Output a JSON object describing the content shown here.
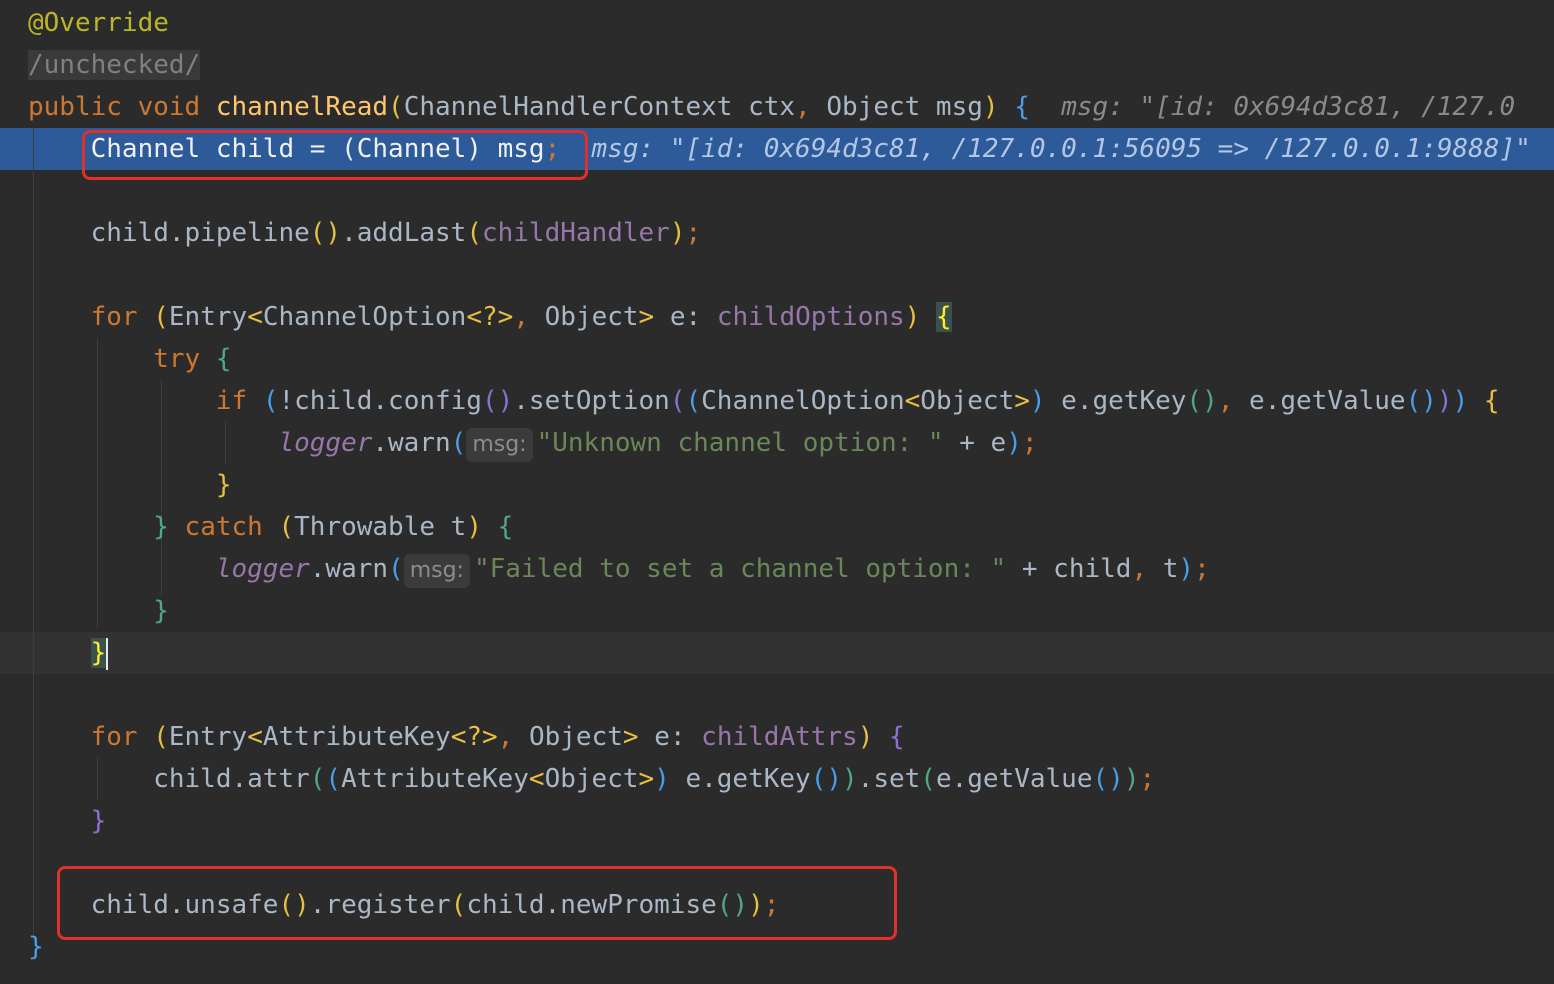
{
  "editor": {
    "lines": [
      {
        "tokens": [
          {
            "t": "@Override",
            "c": "ann"
          }
        ]
      },
      {
        "tokens": [
          {
            "t": "/unchecked/",
            "c": "comment"
          }
        ]
      },
      {
        "tokens": [
          {
            "t": "public",
            "c": "kw"
          },
          {
            "t": " "
          },
          {
            "t": "void",
            "c": "kw"
          },
          {
            "t": " "
          },
          {
            "t": "channelRead",
            "c": "fn"
          },
          {
            "t": "(",
            "c": "p-yellow"
          },
          {
            "t": "ChannelHandlerContext ctx"
          },
          {
            "t": ", ",
            "c": "kw"
          },
          {
            "t": "Object msg"
          },
          {
            "t": ")",
            "c": "p-yellow"
          },
          {
            "t": " "
          },
          {
            "t": "{",
            "c": "p-blue"
          },
          {
            "t": "  "
          },
          {
            "t": "msg: \"[id: 0x694d3c81, /127.0",
            "c": "inlay"
          }
        ]
      },
      {
        "tokens": [
          {
            "t": "    "
          },
          {
            "t": "Channel child = (Channel) msg",
            "c": "exec-text"
          },
          {
            "t": ";",
            "c": "kw"
          },
          {
            "t": "  "
          },
          {
            "t": "msg: \"[id: 0x694d3c81, /127.0.0.1:56095 => /127.0.0.1:9888]\"",
            "c": "exec-inlay"
          }
        ]
      },
      {
        "tokens": []
      },
      {
        "tokens": [
          {
            "t": "    child.pipeline"
          },
          {
            "t": "()",
            "c": "p-yellow"
          },
          {
            "t": ".addLast"
          },
          {
            "t": "(",
            "c": "p-yellow"
          },
          {
            "t": "childHandler",
            "c": "field"
          },
          {
            "t": ")",
            "c": "p-yellow"
          },
          {
            "t": ";",
            "c": "kw"
          }
        ]
      },
      {
        "tokens": []
      },
      {
        "tokens": [
          {
            "t": "    "
          },
          {
            "t": "for",
            "c": "kw"
          },
          {
            "t": " "
          },
          {
            "t": "(",
            "c": "p-yellow"
          },
          {
            "t": "Entry"
          },
          {
            "t": "<",
            "c": "p-yellow"
          },
          {
            "t": "ChannelOption"
          },
          {
            "t": "<?>",
            "c": "p-yellow"
          },
          {
            "t": ", ",
            "c": "kw"
          },
          {
            "t": "Object"
          },
          {
            "t": ">",
            "c": "p-yellow"
          },
          {
            "t": " e: "
          },
          {
            "t": "childOptions",
            "c": "field"
          },
          {
            "t": ")",
            "c": "p-yellow"
          },
          {
            "t": " "
          },
          {
            "t": "{",
            "c": "brace-match"
          }
        ]
      },
      {
        "tokens": [
          {
            "t": "        "
          },
          {
            "t": "try",
            "c": "kw"
          },
          {
            "t": " "
          },
          {
            "t": "{",
            "c": "p-green"
          }
        ]
      },
      {
        "tokens": [
          {
            "t": "            "
          },
          {
            "t": "if",
            "c": "kw"
          },
          {
            "t": " "
          },
          {
            "t": "(",
            "c": "p-blue"
          },
          {
            "t": "!child.config"
          },
          {
            "t": "()",
            "c": "p-purple"
          },
          {
            "t": ".setOption"
          },
          {
            "t": "(",
            "c": "p-purple"
          },
          {
            "t": "(",
            "c": "p-blue"
          },
          {
            "t": "ChannelOption"
          },
          {
            "t": "<",
            "c": "p-yellow"
          },
          {
            "t": "Object"
          },
          {
            "t": ">",
            "c": "p-yellow"
          },
          {
            "t": ")",
            "c": "p-blue"
          },
          {
            "t": " e.getKey"
          },
          {
            "t": "()",
            "c": "p-green"
          },
          {
            "t": ", ",
            "c": "kw"
          },
          {
            "t": "e.getValue"
          },
          {
            "t": "()",
            "c": "p-blue"
          },
          {
            "t": ")",
            "c": "p-purple"
          },
          {
            "t": ")",
            "c": "p-blue"
          },
          {
            "t": " "
          },
          {
            "t": "{",
            "c": "p-yellow"
          }
        ]
      },
      {
        "tokens": [
          {
            "t": "                "
          },
          {
            "t": "logger",
            "c": "static-field"
          },
          {
            "t": ".warn"
          },
          {
            "t": "(",
            "c": "p-blue"
          },
          {
            "t": "msg:",
            "c": "hint"
          },
          {
            "t": "\"Unknown channel option: \"",
            "c": "str"
          },
          {
            "t": " + e"
          },
          {
            "t": ")",
            "c": "p-blue"
          },
          {
            "t": ";",
            "c": "kw"
          }
        ]
      },
      {
        "tokens": [
          {
            "t": "            "
          },
          {
            "t": "}",
            "c": "p-yellow"
          }
        ]
      },
      {
        "tokens": [
          {
            "t": "        "
          },
          {
            "t": "}",
            "c": "p-green"
          },
          {
            "t": " "
          },
          {
            "t": "catch",
            "c": "kw"
          },
          {
            "t": " "
          },
          {
            "t": "(",
            "c": "p-yellow"
          },
          {
            "t": "Throwable t"
          },
          {
            "t": ")",
            "c": "p-yellow"
          },
          {
            "t": " "
          },
          {
            "t": "{",
            "c": "p-green"
          }
        ]
      },
      {
        "tokens": [
          {
            "t": "            "
          },
          {
            "t": "logger",
            "c": "static-field"
          },
          {
            "t": ".warn"
          },
          {
            "t": "(",
            "c": "p-blue"
          },
          {
            "t": "msg:",
            "c": "hint"
          },
          {
            "t": "\"Failed to set a channel option: \"",
            "c": "str"
          },
          {
            "t": " + child"
          },
          {
            "t": ", ",
            "c": "kw"
          },
          {
            "t": "t"
          },
          {
            "t": ")",
            "c": "p-blue"
          },
          {
            "t": ";",
            "c": "kw"
          }
        ]
      },
      {
        "tokens": [
          {
            "t": "        "
          },
          {
            "t": "}",
            "c": "p-green"
          }
        ]
      },
      {
        "tokens": [
          {
            "t": "    "
          },
          {
            "t": "}",
            "c": "brace-match"
          },
          {
            "t": "",
            "c": "caret"
          }
        ]
      },
      {
        "tokens": []
      },
      {
        "tokens": [
          {
            "t": "    "
          },
          {
            "t": "for",
            "c": "kw"
          },
          {
            "t": " "
          },
          {
            "t": "(",
            "c": "p-yellow"
          },
          {
            "t": "Entry"
          },
          {
            "t": "<",
            "c": "p-yellow"
          },
          {
            "t": "AttributeKey"
          },
          {
            "t": "<?>",
            "c": "p-yellow"
          },
          {
            "t": ", ",
            "c": "kw"
          },
          {
            "t": "Object"
          },
          {
            "t": ">",
            "c": "p-yellow"
          },
          {
            "t": " e: "
          },
          {
            "t": "childAttrs",
            "c": "field"
          },
          {
            "t": ")",
            "c": "p-yellow"
          },
          {
            "t": " "
          },
          {
            "t": "{",
            "c": "p-purple"
          }
        ]
      },
      {
        "tokens": [
          {
            "t": "        child.attr"
          },
          {
            "t": "(",
            "c": "p-green"
          },
          {
            "t": "(",
            "c": "p-blue"
          },
          {
            "t": "AttributeKey"
          },
          {
            "t": "<",
            "c": "p-yellow"
          },
          {
            "t": "Object"
          },
          {
            "t": ">",
            "c": "p-yellow"
          },
          {
            "t": ")",
            "c": "p-blue"
          },
          {
            "t": " e.getKey"
          },
          {
            "t": "()",
            "c": "p-blue"
          },
          {
            "t": ")",
            "c": "p-green"
          },
          {
            "t": ".set"
          },
          {
            "t": "(",
            "c": "p-green"
          },
          {
            "t": "e.getValue"
          },
          {
            "t": "()",
            "c": "p-blue"
          },
          {
            "t": ")",
            "c": "p-green"
          },
          {
            "t": ";",
            "c": "kw"
          }
        ]
      },
      {
        "tokens": [
          {
            "t": "    "
          },
          {
            "t": "}",
            "c": "p-purple"
          }
        ]
      },
      {
        "tokens": []
      },
      {
        "tokens": [
          {
            "t": "    child.unsafe"
          },
          {
            "t": "()",
            "c": "p-yellow"
          },
          {
            "t": ".register"
          },
          {
            "t": "(",
            "c": "p-yellow"
          },
          {
            "t": "child.newPromise"
          },
          {
            "t": "()",
            "c": "p-green"
          },
          {
            "t": ")",
            "c": "p-yellow"
          },
          {
            "t": ";",
            "c": "kw"
          }
        ]
      },
      {
        "tokens": [
          {
            "t": "}",
            "c": "p-blue"
          }
        ]
      }
    ]
  }
}
